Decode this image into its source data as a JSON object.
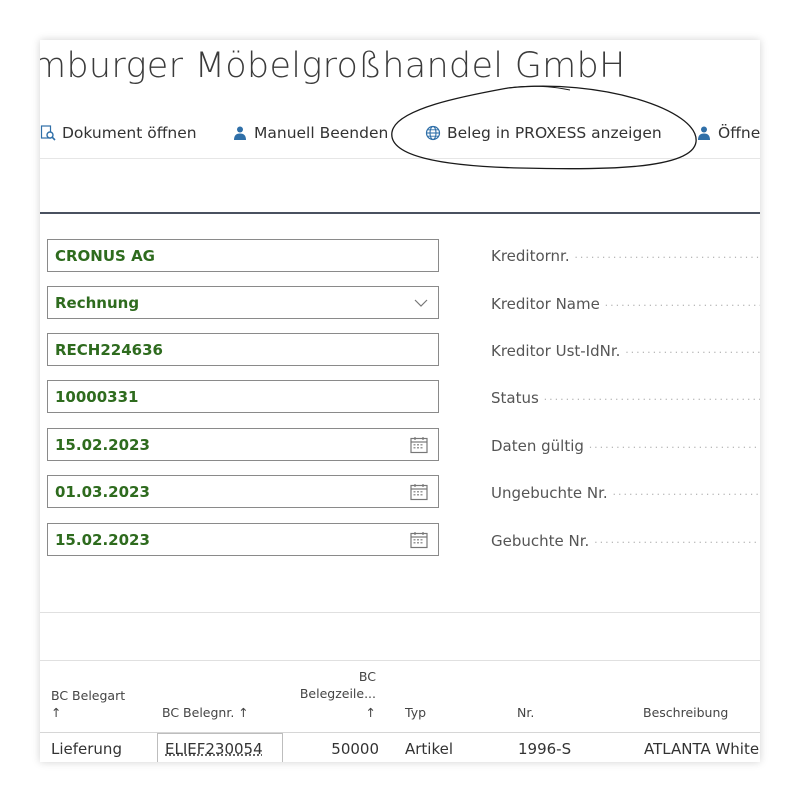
{
  "header": {
    "title": "mburger Möbelgroßhandel GmbH"
  },
  "actions": [
    {
      "label": "Dokument öffnen",
      "icon": "document-search-icon"
    },
    {
      "label": "Manuell Beenden",
      "icon": "person-icon"
    },
    {
      "label": "Beleg in PROXESS anzeigen",
      "icon": "globe-icon"
    },
    {
      "label": "Öffne",
      "icon": "person-icon"
    }
  ],
  "fields": {
    "company": "CRONUS AG",
    "doc_type": "Rechnung",
    "doc_no": "RECH224636",
    "vendor_no": "10000331",
    "date1": "15.02.2023",
    "date2": "01.03.2023",
    "date3": "15.02.2023"
  },
  "labels": {
    "kreditornr": "Kreditornr.",
    "kreditor_name": "Kreditor Name",
    "kreditor_ust": "Kreditor Ust-IdNr.",
    "status": "Status",
    "daten_gueltig": "Daten gültig",
    "ungebuchte_nr": "Ungebuchte Nr.",
    "gebuchte_nr": "Gebuchte Nr."
  },
  "table": {
    "headers": {
      "bc_belegart": "BC Belegart",
      "bc_belegnr": "BC Belegnr. ↑",
      "bc_top": "BC",
      "bc_belegzeile": "Belegzeile...",
      "typ": "Typ",
      "nr": "Nr.",
      "beschreibung": "Beschreibung",
      "arrow": "↑"
    },
    "row": {
      "belegart": "Lieferung",
      "belegnr": "ELIEF230054",
      "belegzeile": "50000",
      "typ": "Artikel",
      "nr": "1996-S",
      "beschreibung": "ATLANTA White"
    }
  },
  "colors": {
    "field_value": "#2e6b1e",
    "accent_bar": "#4a5160"
  }
}
